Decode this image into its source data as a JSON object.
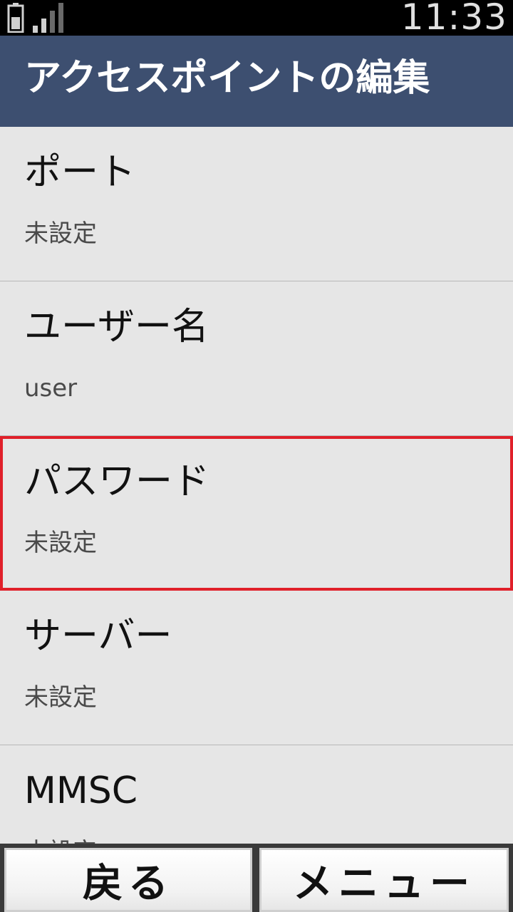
{
  "status_bar": {
    "time": "11:33",
    "battery_icon": "battery-icon",
    "signal_icon": "signal-strength-icon"
  },
  "header": {
    "title": "アクセスポイントの編集"
  },
  "settings": [
    {
      "label": "ポート",
      "value": "未設定"
    },
    {
      "label": "ユーザー名",
      "value": "user"
    },
    {
      "label": "パスワード",
      "value": "未設定",
      "selected": true
    },
    {
      "label": "サーバー",
      "value": "未設定"
    },
    {
      "label": "MMSC",
      "value": "未設定"
    }
  ],
  "softkeys": {
    "back_label": "戻る",
    "menu_label": "メニュー"
  },
  "colors": {
    "header_bg": "#3d4f70",
    "list_bg": "#e6e6e6",
    "selection_border": "#e0202a"
  }
}
